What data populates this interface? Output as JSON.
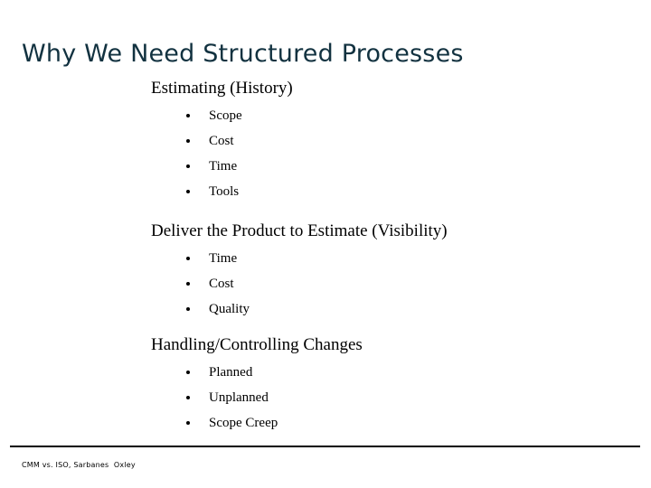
{
  "slide": {
    "title": "Why We Need Structured Processes",
    "title_color": "#123240",
    "background_color": "#ffffff",
    "body_text_color": "#000000",
    "rule_color": "#000000"
  },
  "groups": [
    {
      "heading": "Estimating (History)",
      "bullets": [
        {
          "label": "Scope"
        },
        {
          "label": "Cost"
        },
        {
          "label": "Time"
        },
        {
          "label": "Tools"
        }
      ]
    },
    {
      "heading": "Deliver the Product to Estimate (Visibility)",
      "bullets": [
        {
          "label": "Time"
        },
        {
          "label": "Cost"
        },
        {
          "label": "Quality"
        }
      ]
    },
    {
      "heading": "Handling/Controlling Changes",
      "bullets": [
        {
          "label": "Planned"
        },
        {
          "label": "Unplanned"
        },
        {
          "label": "Scope Creep"
        }
      ]
    }
  ],
  "footer": {
    "text": "CMM vs. ISO, Sarbanes  Oxley"
  }
}
